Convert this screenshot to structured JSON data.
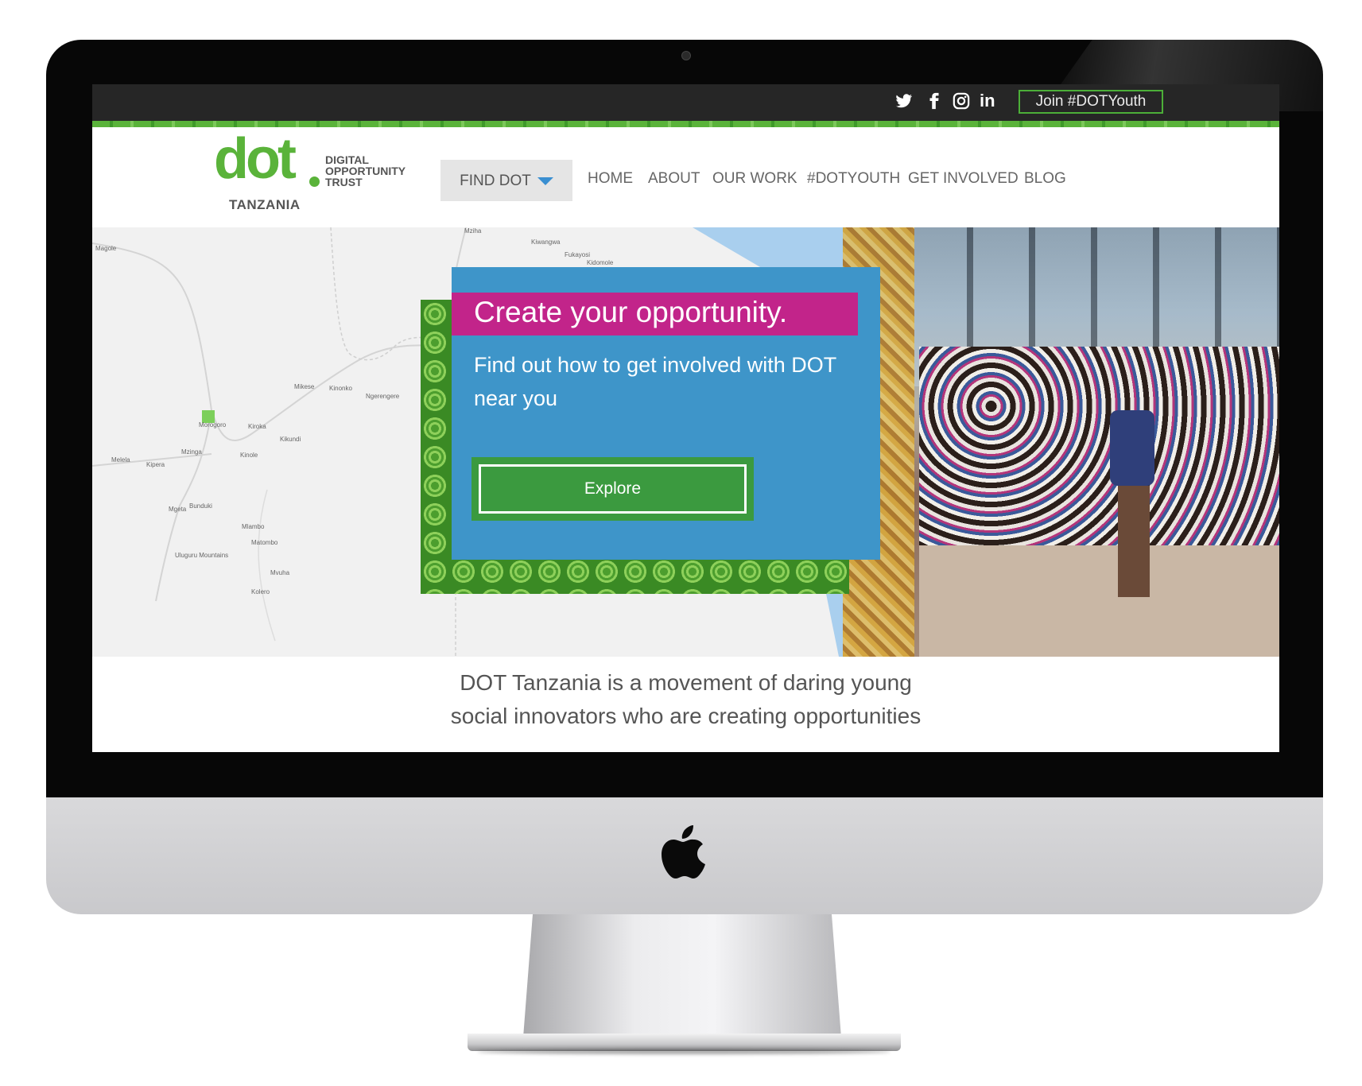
{
  "social": {
    "twitter": "t",
    "facebook": "f",
    "instagram": "◎",
    "linkedin": "in"
  },
  "topbar": {
    "join_label": "Join #DOTYouth"
  },
  "logo": {
    "word": "dot",
    "tagline_1": "DIGITAL",
    "tagline_2": "OPPORTUNITY",
    "tagline_3": "TRUST",
    "country": "TANZANIA"
  },
  "find_dot": {
    "label": "FIND DOT"
  },
  "nav": [
    "HOME",
    "ABOUT",
    "OUR WORK",
    "#DOTYOUTH",
    "GET INVOLVED",
    "BLOG"
  ],
  "map": {
    "labels": [
      "Magole",
      "Mziha",
      "Kiwangwa",
      "Fukayosi",
      "Kidomole",
      "Mikese",
      "Kinonko",
      "Ngerengere",
      "Morogoro",
      "Kiroka",
      "Kikundi",
      "Melela",
      "Kipera",
      "Mzinga",
      "Kinole",
      "Mgeta",
      "Bunduki",
      "Mlambo",
      "Matombo",
      "Mvuha",
      "Kolero",
      "Uluguru Mountains"
    ],
    "marker_color": "#7ccf5a"
  },
  "hero": {
    "headline": "Create your opportunity.",
    "subheading": "Find out how to get involved with DOT near you",
    "cta_label": "Explore"
  },
  "intro": {
    "line_1": "DOT Tanzania is a movement of daring young",
    "line_2": "social innovators who are creating opportunities"
  },
  "colors": {
    "brand_green": "#5ab33a",
    "hero_blue": "#3e95c9",
    "hero_magenta": "#c2248a",
    "button_green": "#3b9a3f"
  }
}
